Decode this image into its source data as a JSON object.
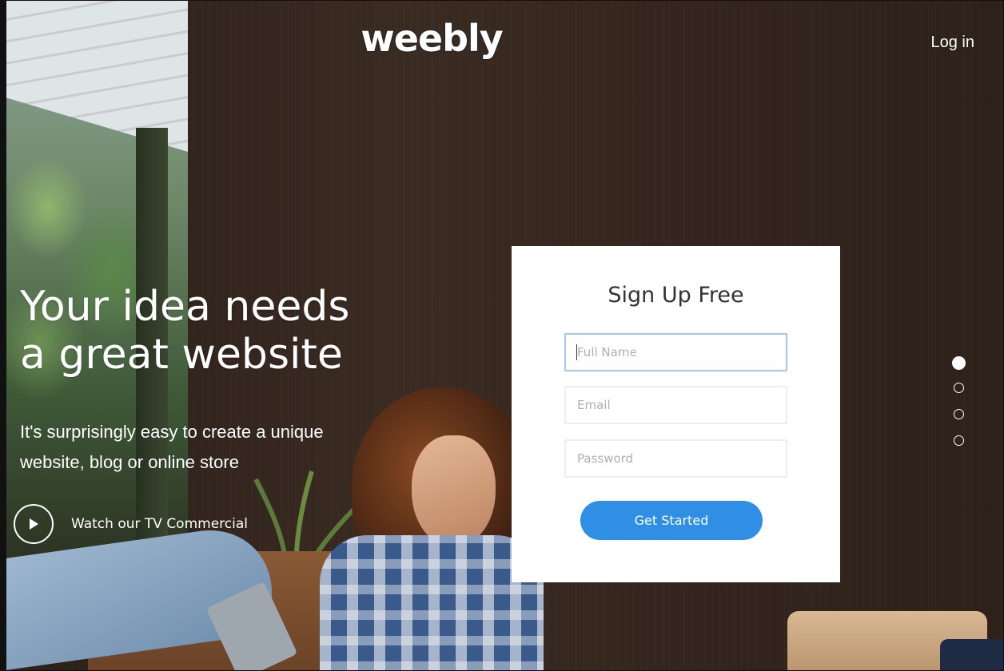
{
  "header": {
    "logo_text": "weebly",
    "login_label": "Log in"
  },
  "hero": {
    "headline_line1": "Your idea needs",
    "headline_line2": "a great website",
    "subhead_line1": "It's surprisingly easy to create a unique",
    "subhead_line2": "website, blog or online store",
    "watch_label": "Watch our TV Commercial"
  },
  "signup": {
    "title": "Sign Up Free",
    "full_name_placeholder": "Full Name",
    "full_name_value": "",
    "email_placeholder": "Email",
    "email_value": "",
    "password_placeholder": "Password",
    "password_value": "",
    "submit_label": "Get Started",
    "accent_color": "#2f8fe4"
  },
  "carousel": {
    "slide_count": 4,
    "active_slide": 1
  },
  "icons": {
    "play": "play-icon",
    "dot_active": "dot-active-icon",
    "dot_inactive": "dot-inactive-icon"
  }
}
